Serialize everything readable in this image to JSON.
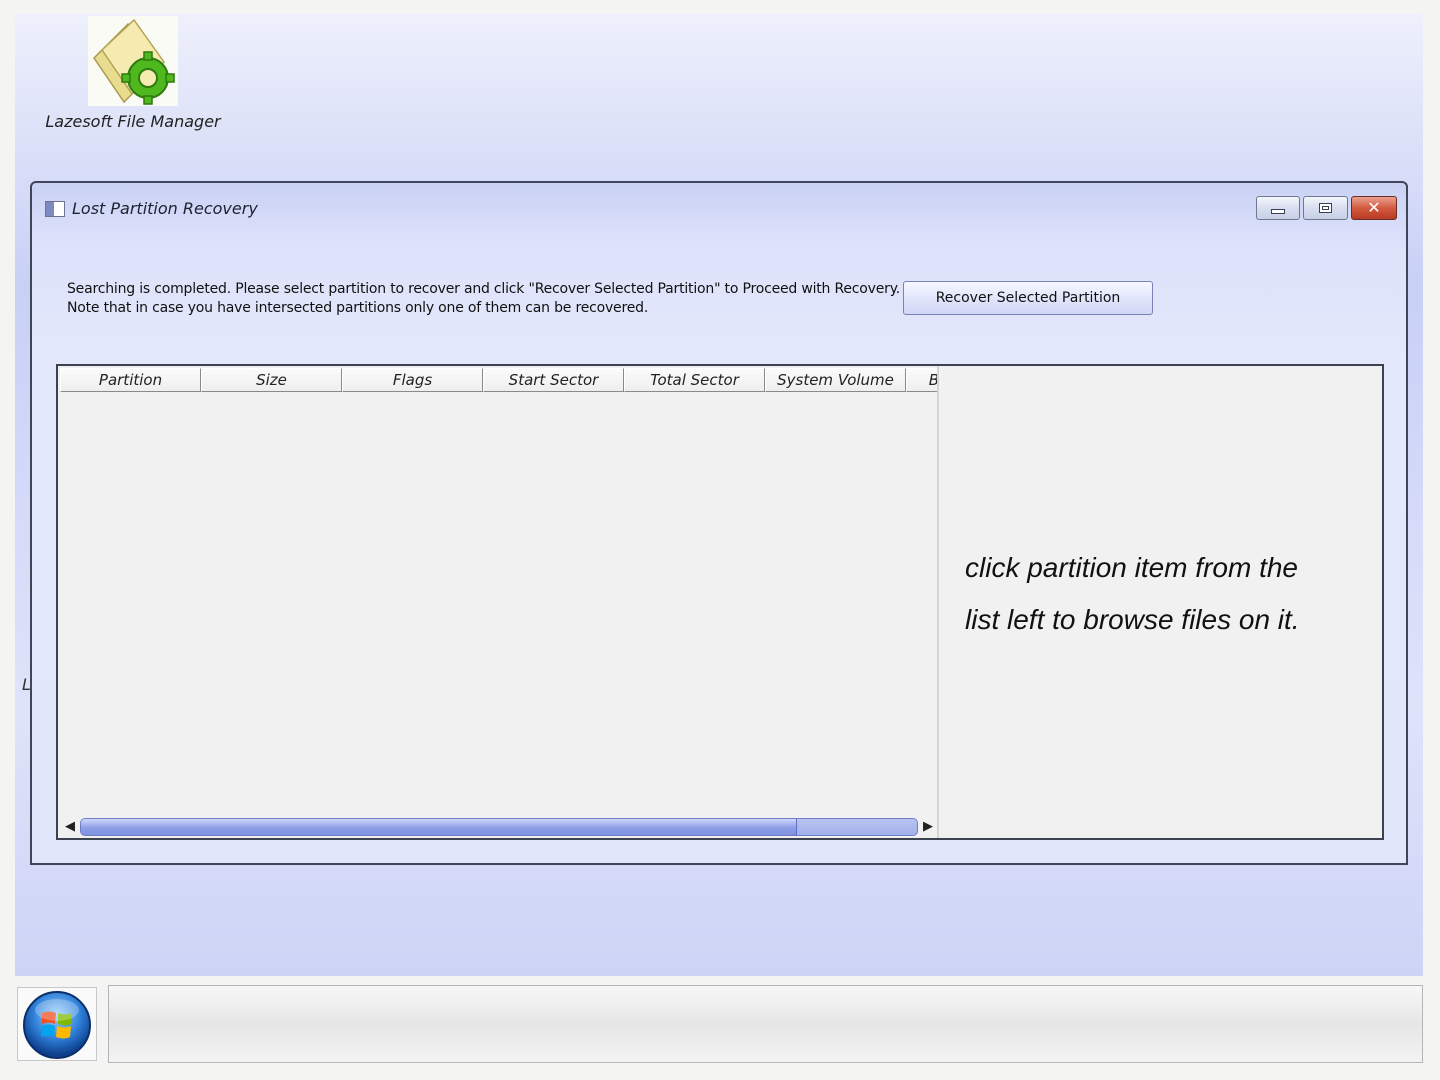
{
  "desktop": {
    "icon_label": "Lazesoft File Manager",
    "stray_text": "L"
  },
  "window": {
    "title": "Lost Partition Recovery",
    "instructions_line1": "Searching is completed. Please select partition to recover and click \"Recover Selected Partition\" to Proceed with Recovery.",
    "instructions_line2": "Note that in case you have intersected partitions only one of them can be recovered.",
    "recover_button_label": "Recover Selected Partition",
    "table": {
      "columns": [
        "Partition",
        "Size",
        "Flags",
        "Start Sector",
        "Total Sector",
        "System Volume",
        "B"
      ],
      "rows": [],
      "scroll_position": 0.855
    },
    "preview_message_line1": "click partition item from the",
    "preview_message_line2": "list left to browse files on it."
  },
  "taskbar": {
    "start_icon": "windows-logo-icon"
  }
}
